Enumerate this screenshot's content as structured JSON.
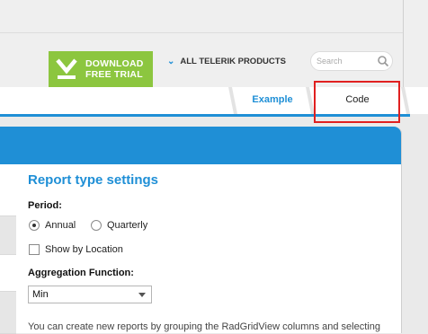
{
  "header": {
    "download_line1": "DOWNLOAD",
    "download_line2": "FREE TRIAL",
    "products_label": "ALL TELERIK PRODUCTS",
    "search_placeholder": "Search",
    "accent_color": "#8cc63f"
  },
  "tabs": [
    {
      "label": "Example",
      "active": true
    },
    {
      "label": "Code",
      "active": false
    }
  ],
  "panel": {
    "title": "Report type settings",
    "period_label": "Period:",
    "period_options": [
      {
        "label": "Annual",
        "checked": true
      },
      {
        "label": "Quarterly",
        "checked": false
      }
    ],
    "show_by_location": {
      "label": "Show by Location",
      "checked": false
    },
    "aggregation_label": "Aggregation Function:",
    "aggregation_value": "Min",
    "description": "You can create new reports by grouping the RadGridView columns and selecting"
  },
  "colors": {
    "brand_blue": "#1f8fd6",
    "highlight_red": "#e02020"
  }
}
